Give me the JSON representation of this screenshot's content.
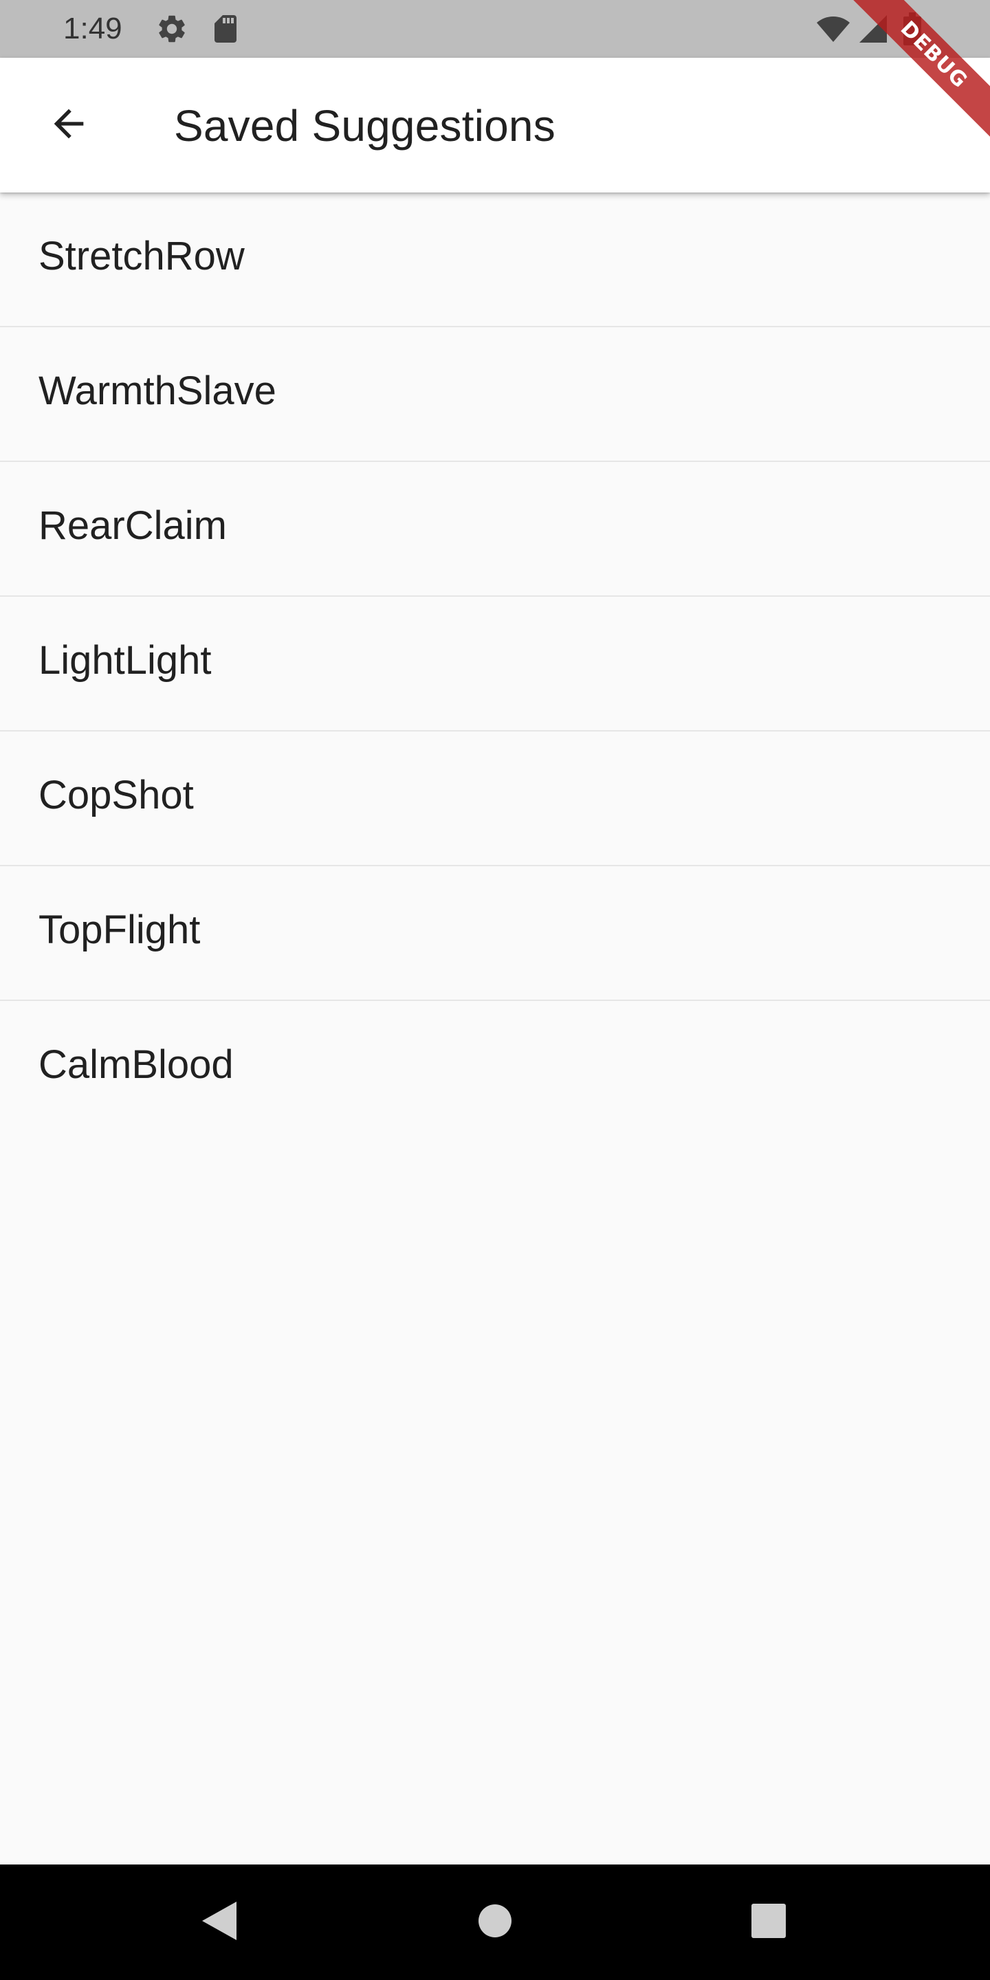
{
  "status_bar": {
    "time": "1:49",
    "icons": [
      "settings-gear-icon",
      "sd-card-icon",
      "wifi-icon",
      "cell-signal-icon",
      "battery-icon"
    ]
  },
  "app_bar": {
    "title": "Saved Suggestions",
    "back_icon": "arrow-back-icon"
  },
  "debug_banner": {
    "label": "DEBUG"
  },
  "saved_list": {
    "items": [
      {
        "label": "StretchRow"
      },
      {
        "label": "WarmthSlave"
      },
      {
        "label": "RearClaim"
      },
      {
        "label": "LightLight"
      },
      {
        "label": "CopShot"
      },
      {
        "label": "TopFlight"
      },
      {
        "label": "CalmBlood"
      }
    ]
  },
  "nav_bar": {
    "buttons": [
      "back-triangle-icon",
      "home-circle-icon",
      "recents-square-icon"
    ]
  },
  "colors": {
    "status_bar_bg": "#bdbdbd",
    "app_bar_bg": "#ffffff",
    "page_bg": "#fafafa",
    "divider": "#e6e6e6",
    "text_primary": "#212121",
    "debug_ribbon": "#b71c1c",
    "nav_bar_bg": "#000000"
  }
}
